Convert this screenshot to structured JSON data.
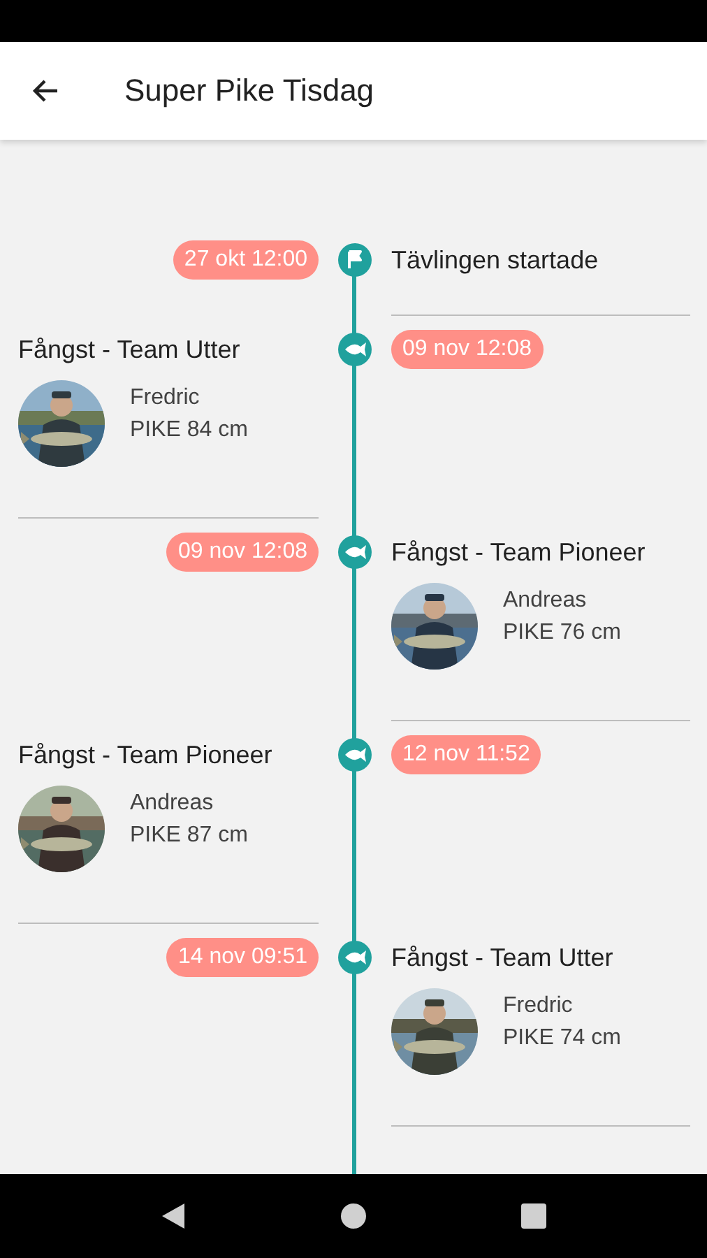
{
  "app_bar": {
    "title": "Super Pike Tisdag"
  },
  "timeline": [
    {
      "kind": "start",
      "content_left": false,
      "date": "27 okt 12:00",
      "text": "Tävlingen startade"
    },
    {
      "kind": "catch",
      "content_left": true,
      "date": "09 nov 12:08",
      "title": "Fångst - Team Utter",
      "angler": "Fredric",
      "catch": "PIKE 84 cm"
    },
    {
      "kind": "catch",
      "content_left": false,
      "date": "09 nov 12:08",
      "title": "Fångst - Team Pioneer",
      "angler": "Andreas",
      "catch": "PIKE 76 cm"
    },
    {
      "kind": "catch",
      "content_left": true,
      "date": "12 nov 11:52",
      "title": "Fångst - Team Pioneer",
      "angler": "Andreas",
      "catch": "PIKE 87 cm"
    },
    {
      "kind": "catch",
      "content_left": false,
      "date": "14 nov 09:51",
      "title": "Fångst - Team Utter",
      "angler": "Fredric",
      "catch": "PIKE 74 cm"
    }
  ]
}
